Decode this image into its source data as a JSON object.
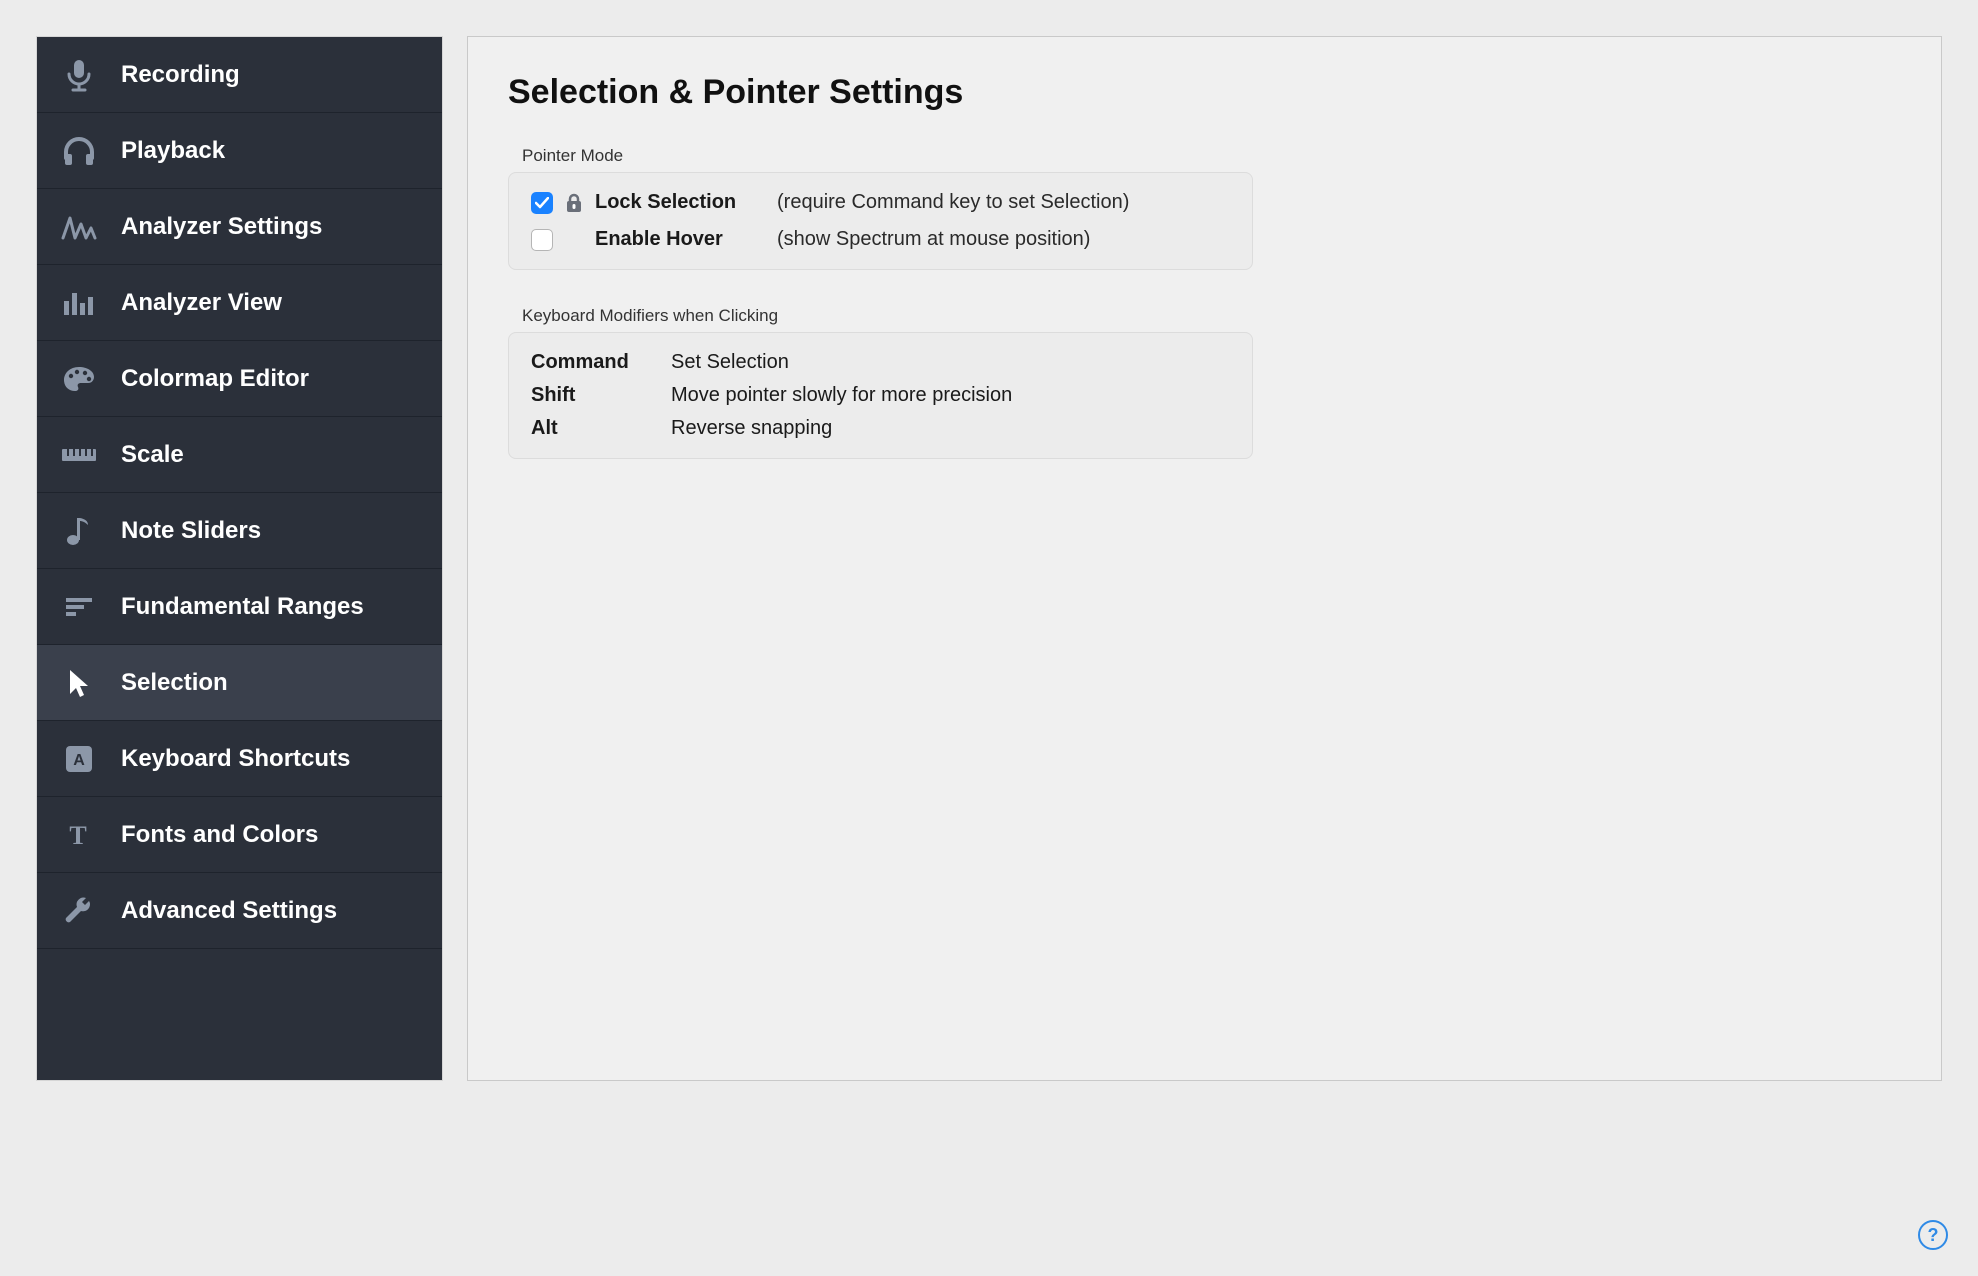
{
  "sidebar": {
    "items": [
      {
        "label": "Recording",
        "icon": "microphone-icon",
        "selected": false
      },
      {
        "label": "Playback",
        "icon": "headphones-icon",
        "selected": false
      },
      {
        "label": "Analyzer Settings",
        "icon": "waveform-icon",
        "selected": false
      },
      {
        "label": "Analyzer View",
        "icon": "bars-icon",
        "selected": false
      },
      {
        "label": "Colormap Editor",
        "icon": "palette-icon",
        "selected": false
      },
      {
        "label": "Scale",
        "icon": "ruler-icon",
        "selected": false
      },
      {
        "label": "Note Sliders",
        "icon": "note-icon",
        "selected": false
      },
      {
        "label": "Fundamental Ranges",
        "icon": "ranges-icon",
        "selected": false
      },
      {
        "label": "Selection",
        "icon": "cursor-icon",
        "selected": true
      },
      {
        "label": "Keyboard Shortcuts",
        "icon": "keycap-icon",
        "selected": false
      },
      {
        "label": "Fonts and Colors",
        "icon": "typography-icon",
        "selected": false
      },
      {
        "label": "Advanced Settings",
        "icon": "wrench-icon",
        "selected": false
      }
    ]
  },
  "main": {
    "title": "Selection & Pointer Settings",
    "section1": {
      "label": "Pointer Mode",
      "rows": [
        {
          "checked": true,
          "show_lock": true,
          "label": "Lock Selection",
          "desc": "(require Command key to set Selection)"
        },
        {
          "checked": false,
          "show_lock": false,
          "label": "Enable Hover",
          "desc": "(show Spectrum at mouse position)"
        }
      ]
    },
    "section2": {
      "label": "Keyboard Modifiers when Clicking",
      "rows": [
        {
          "key": "Command",
          "val": "Set Selection"
        },
        {
          "key": "Shift",
          "val": "Move pointer slowly for more precision"
        },
        {
          "key": "Alt",
          "val": "Reverse snapping"
        }
      ]
    }
  },
  "help_label": "?"
}
